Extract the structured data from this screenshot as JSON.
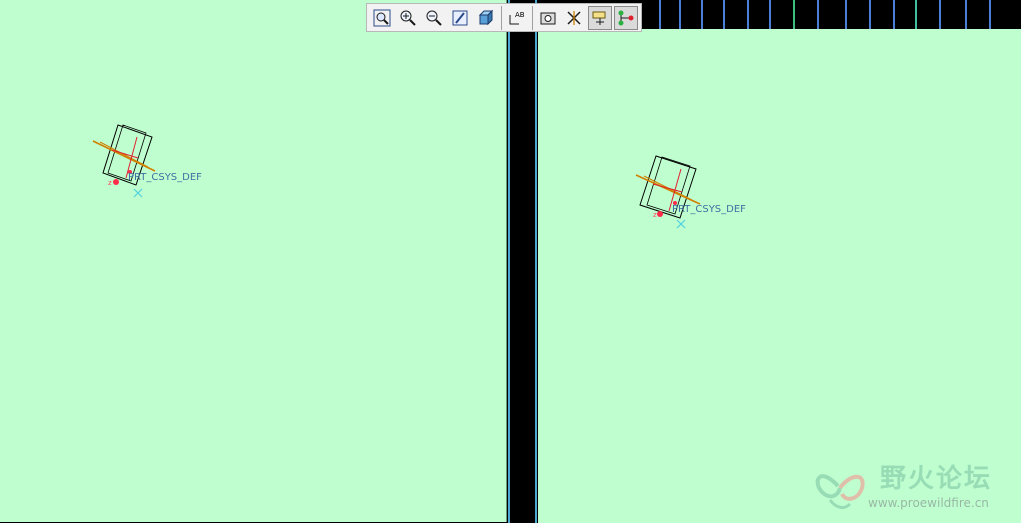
{
  "toolbar": {
    "buttons": [
      {
        "icon": "zoom-fit-icon",
        "active": false
      },
      {
        "icon": "zoom-in-icon",
        "active": false
      },
      {
        "icon": "zoom-out-icon",
        "active": false
      },
      {
        "icon": "repaint-icon",
        "active": false
      },
      {
        "icon": "shading-icon",
        "active": false
      },
      {
        "icon": "annotation-display-icon",
        "active": false
      },
      {
        "icon": "view-manager-icon",
        "active": false
      },
      {
        "icon": "datum-plane-display-icon",
        "active": false
      },
      {
        "icon": "datum-axis-display-icon",
        "active": true
      },
      {
        "icon": "datum-point-display-icon",
        "active": true
      }
    ]
  },
  "viewports": {
    "left": {
      "csys_label": "PRT_CSYS_DEF"
    },
    "right": {
      "csys_label": "PRT_CSYS_DEF"
    }
  },
  "watermark": {
    "title": "野火论坛",
    "url": "www.proewildfire.cn"
  },
  "colors": {
    "background": "#bfffcf",
    "model_outline": "#000000",
    "csys_x": "#e02030",
    "datum_axis": "#d08000",
    "label": "#3f6fa3"
  }
}
